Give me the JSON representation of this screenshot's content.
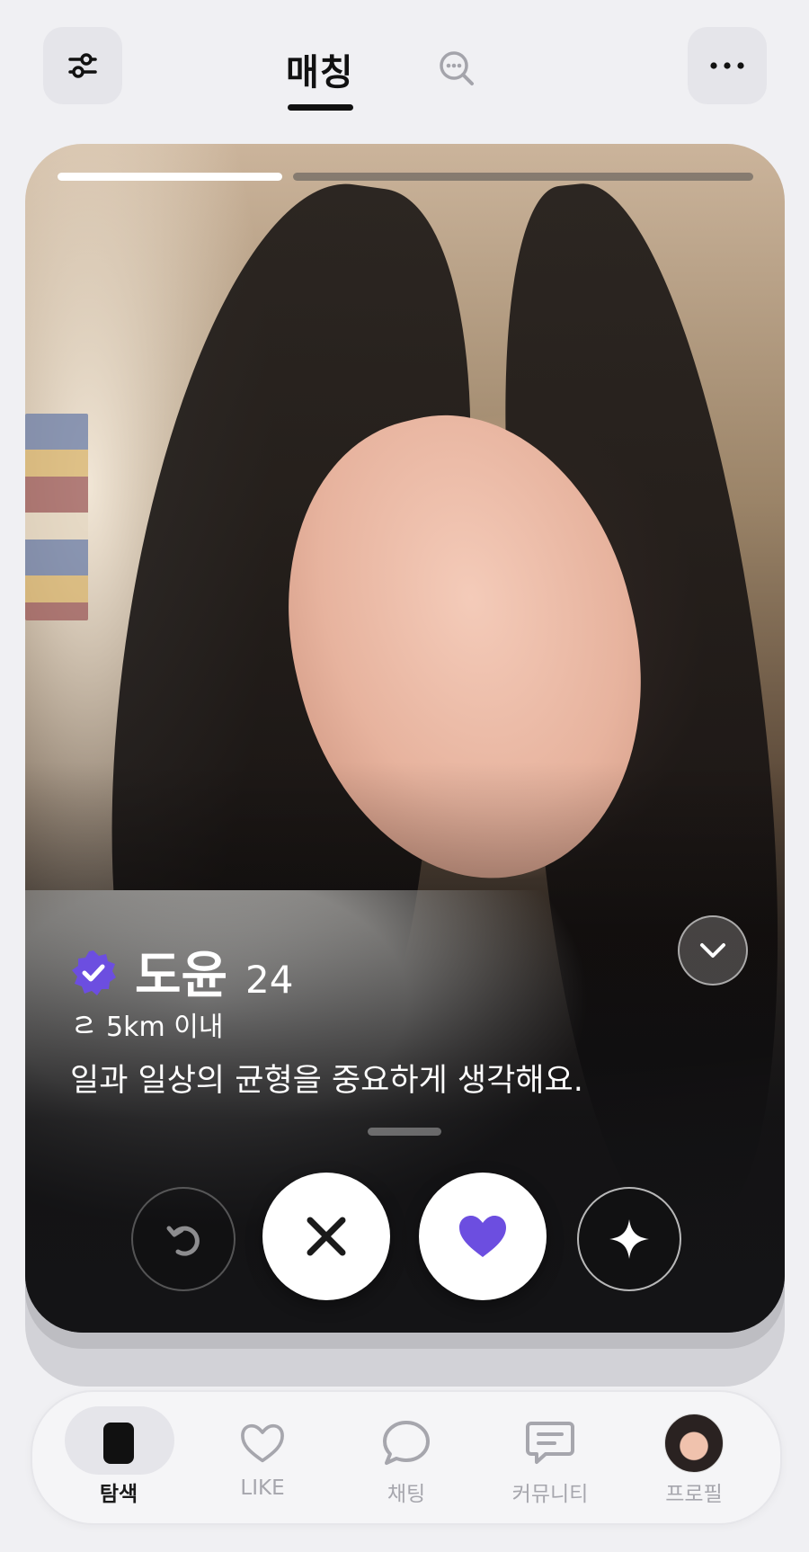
{
  "header": {
    "title": "매칭",
    "filter_icon": "sliders-icon",
    "search_icon": "chat-search-icon",
    "more_icon": "more-horizontal-icon"
  },
  "profile": {
    "photo_index": 1,
    "photo_count": 2,
    "name": "도윤",
    "age": "24",
    "verified": true,
    "distance": "5km 이내",
    "bio": "일과 일상의 균형을 중요하게 생각해요."
  },
  "actions": {
    "undo_icon": "undo-icon",
    "pass_icon": "close-icon",
    "like_icon": "heart-icon",
    "superlike_icon": "sparkle-icon"
  },
  "nav": {
    "items": [
      {
        "label": "탐색",
        "icon": "card-icon",
        "active": true
      },
      {
        "label": "LIKE",
        "icon": "heart-outline-icon",
        "active": false
      },
      {
        "label": "채팅",
        "icon": "chat-bubble-icon",
        "active": false
      },
      {
        "label": "커뮤니티",
        "icon": "message-square-icon",
        "active": false
      },
      {
        "label": "프로필",
        "icon": "avatar-icon",
        "active": false
      }
    ]
  },
  "colors": {
    "accent": "#6c4ee0",
    "background": "#f0f0f3"
  }
}
